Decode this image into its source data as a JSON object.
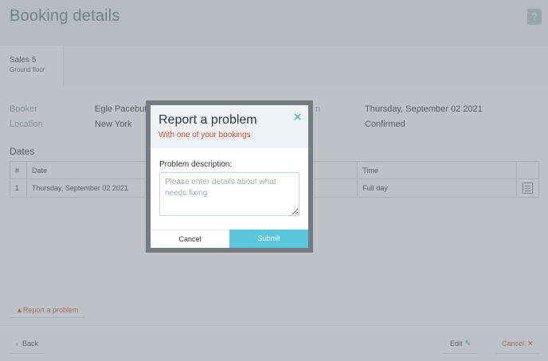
{
  "header": {
    "title": "Booking details",
    "help_label": "?"
  },
  "room": {
    "name": "Sales 5",
    "floor": "Ground floor"
  },
  "info": {
    "booker_label": "Booker",
    "booker_value": "Egle Pacebuta",
    "location_label": "Location",
    "location_value": "New York",
    "right_label_partial": "n",
    "date_value": "Thursday, September 02 2021",
    "status_value": "Confirmed"
  },
  "dates": {
    "title": "Dates",
    "columns": [
      "#",
      "Date",
      "Time",
      ""
    ],
    "rows": [
      {
        "index": "1",
        "date": "Thursday, September 02 2021",
        "time": "Full day"
      }
    ]
  },
  "report_link_label": "Report a problem",
  "footer": {
    "back_label": "Back",
    "edit_label": "Edit",
    "cancel_label": "Cancel"
  },
  "modal": {
    "title": "Report a problem",
    "subtitle": "With one of your bookings",
    "field_label": "Problem description:",
    "field_placeholder": "Please enter details about what needs fixing",
    "field_value": "",
    "cancel_label": "Cancel",
    "submit_label": "Submit"
  },
  "colors": {
    "accent": "#5bc6dc",
    "danger": "#d4503a",
    "edit_icon": "#3aa88c"
  }
}
